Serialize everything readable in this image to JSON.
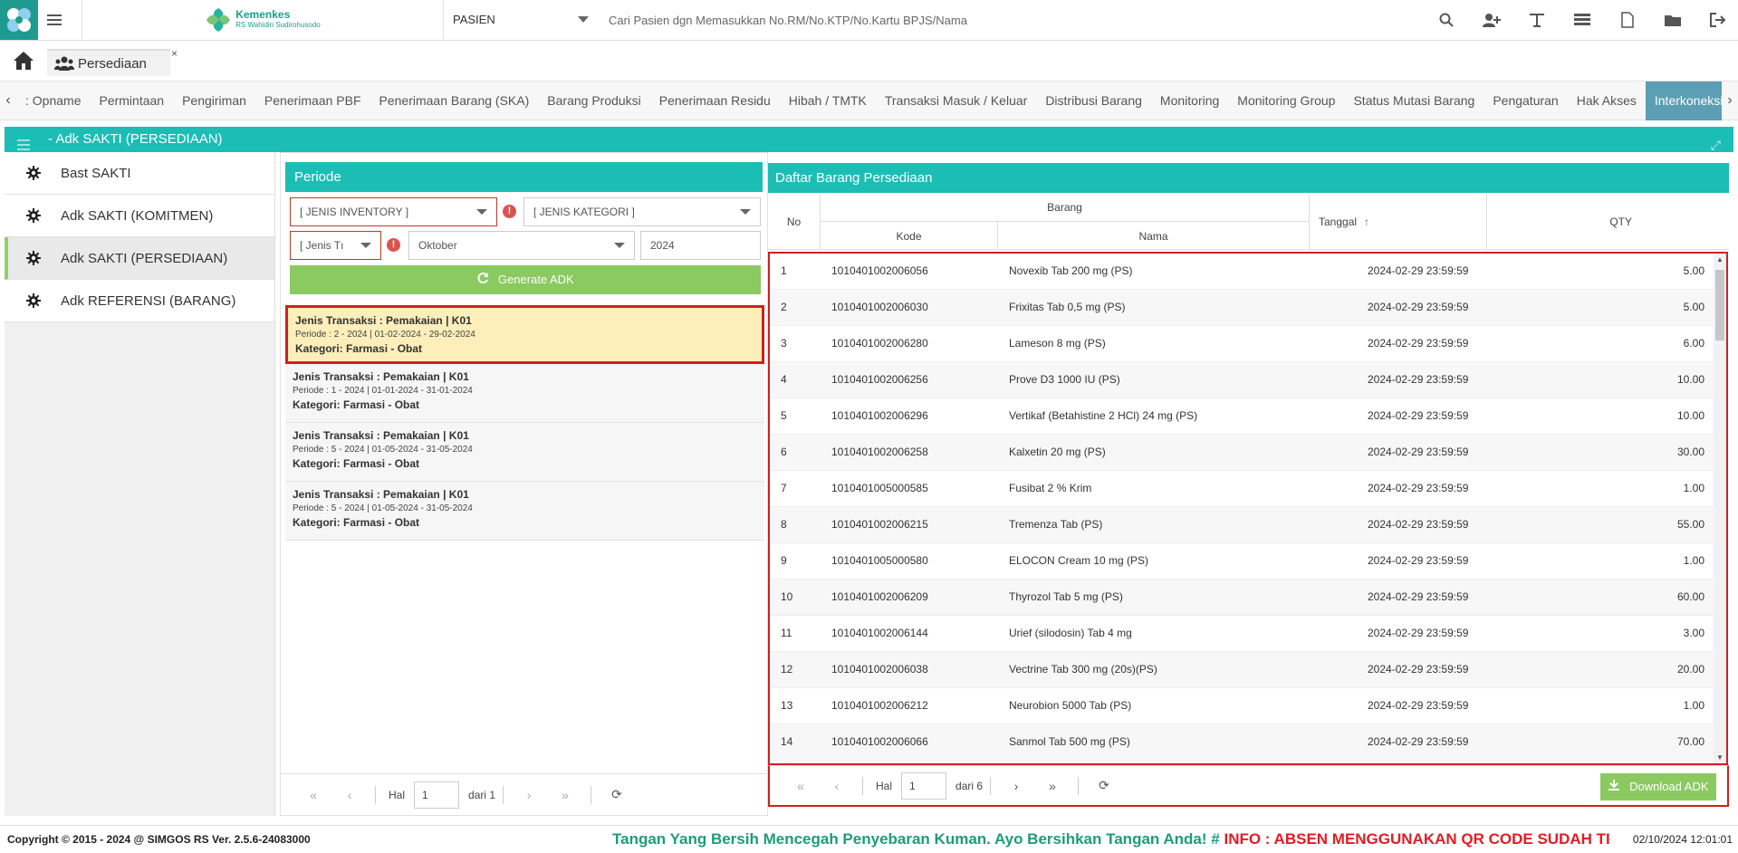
{
  "header": {
    "brand_title": "Kemenkes",
    "brand_sub": "RS Wahidin Sudirohusodo",
    "patient_select": "PASIEN",
    "search_placeholder": "Cari Pasien dgn Memasukkan No.RM/No.KTP/No.Kartu BPJS/Nama",
    "icons": [
      "search-icon",
      "add-user-icon",
      "text-icon",
      "list-icon",
      "pdf-icon",
      "folder-icon",
      "logout-icon"
    ]
  },
  "tab": {
    "label": "Persediaan",
    "close": "×"
  },
  "menu": {
    "items": [
      ": Opname",
      "Permintaan",
      "Pengiriman",
      "Penerimaan PBF",
      "Penerimaan Barang (SKA)",
      "Barang Produksi",
      "Penerimaan Residu",
      "Hibah / TMTK",
      "Transaksi Masuk / Keluar",
      "Distribusi Barang",
      "Monitoring",
      "Monitoring Group",
      "Status Mutasi Barang",
      "Pengaturan",
      "Hak Akses",
      "Interkoneksi SAKTI"
    ],
    "active": "Interkoneksi SAKTI"
  },
  "panel": {
    "title": "- Adk SAKTI (PERSEDIAAN)"
  },
  "sidebar": {
    "items": [
      "Bast SAKTI",
      "Adk SAKTI (KOMITMEN)",
      "Adk SAKTI (PERSEDIAAN)",
      "Adk REFERENSI (BARANG)"
    ],
    "active": "Adk SAKTI (PERSEDIAAN)"
  },
  "periode": {
    "title": "Periode",
    "jenis_inventory": "[ JENIS INVENTORY ]",
    "jenis_kategori": "[ JENIS KATEGORI ]",
    "jenis_transaksi": "[ Jenis Tı",
    "bulan": "Oktober",
    "tahun": "2024",
    "generate_label": "Generate ADK",
    "list": [
      {
        "l1": "Jenis Transaksi : Pemakaian | K01",
        "l2": "Periode : 2 - 2024 | 01-02-2024 - 29-02-2024",
        "l3": "Kategori: Farmasi - Obat"
      },
      {
        "l1": "Jenis Transaksi : Pemakaian | K01",
        "l2": "Periode : 1 - 2024 | 01-01-2024 - 31-01-2024",
        "l3": "Kategori: Farmasi - Obat"
      },
      {
        "l1": "Jenis Transaksi : Pemakaian | K01",
        "l2": "Periode : 5 - 2024 | 01-05-2024 - 31-05-2024",
        "l3": "Kategori: Farmasi - Obat"
      },
      {
        "l1": "Jenis Transaksi : Pemakaian | K01",
        "l2": "Periode : 5 - 2024 | 01-05-2024 - 31-05-2024",
        "l3": "Kategori: Farmasi - Obat"
      }
    ],
    "pager": {
      "hal": "Hal",
      "page": "1",
      "dari": "dari 1"
    }
  },
  "barang": {
    "title": "Daftar Barang Persediaan",
    "headers": {
      "no": "No",
      "barang": "Barang",
      "kode": "Kode",
      "nama": "Nama",
      "tanggal": "Tanggal",
      "qty": "QTY"
    },
    "rows": [
      {
        "no": "1",
        "kode": "1010401002006056",
        "nama": "Novexib Tab 200 mg (PS)",
        "tanggal": "2024-02-29 23:59:59",
        "qty": "5.00"
      },
      {
        "no": "2",
        "kode": "1010401002006030",
        "nama": "Frixitas Tab 0,5 mg (PS)",
        "tanggal": "2024-02-29 23:59:59",
        "qty": "5.00"
      },
      {
        "no": "3",
        "kode": "1010401002006280",
        "nama": "Lameson 8 mg (PS)",
        "tanggal": "2024-02-29 23:59:59",
        "qty": "6.00"
      },
      {
        "no": "4",
        "kode": "1010401002006256",
        "nama": "Prove D3 1000 IU (PS)",
        "tanggal": "2024-02-29 23:59:59",
        "qty": "10.00"
      },
      {
        "no": "5",
        "kode": "1010401002006296",
        "nama": "Vertikaf (Betahistine 2 HCl) 24 mg (PS)",
        "tanggal": "2024-02-29 23:59:59",
        "qty": "10.00"
      },
      {
        "no": "6",
        "kode": "1010401002006258",
        "nama": "Kalxetin 20 mg (PS)",
        "tanggal": "2024-02-29 23:59:59",
        "qty": "30.00"
      },
      {
        "no": "7",
        "kode": "1010401005000585",
        "nama": "Fusibat 2 % Krim",
        "tanggal": "2024-02-29 23:59:59",
        "qty": "1.00"
      },
      {
        "no": "8",
        "kode": "1010401002006215",
        "nama": "Tremenza Tab (PS)",
        "tanggal": "2024-02-29 23:59:59",
        "qty": "55.00"
      },
      {
        "no": "9",
        "kode": "1010401005000580",
        "nama": "ELOCON Cream 10 mg (PS)",
        "tanggal": "2024-02-29 23:59:59",
        "qty": "1.00"
      },
      {
        "no": "10",
        "kode": "1010401002006209",
        "nama": "Thyrozol Tab 5 mg (PS)",
        "tanggal": "2024-02-29 23:59:59",
        "qty": "60.00"
      },
      {
        "no": "11",
        "kode": "1010401002006144",
        "nama": "Urief (silodosin) Tab 4 mg",
        "tanggal": "2024-02-29 23:59:59",
        "qty": "3.00"
      },
      {
        "no": "12",
        "kode": "1010401002006038",
        "nama": "Vectrine Tab 300 mg (20s)(PS)",
        "tanggal": "2024-02-29 23:59:59",
        "qty": "20.00"
      },
      {
        "no": "13",
        "kode": "1010401002006212",
        "nama": "Neurobion 5000 Tab (PS)",
        "tanggal": "2024-02-29 23:59:59",
        "qty": "1.00"
      },
      {
        "no": "14",
        "kode": "1010401002006066",
        "nama": "Sanmol Tab 500 mg (PS)",
        "tanggal": "2024-02-29 23:59:59",
        "qty": "70.00"
      }
    ],
    "pager": {
      "hal": "Hal",
      "page": "1",
      "dari": "dari 6"
    },
    "download_label": "Download ADK"
  },
  "footer": {
    "copyright": "Copyright © 2015 - 2024 @ SIMGOS RS Ver. 2.5.6-24083000",
    "marquee_green": "Tangan Yang Bersih Mencegah Penyebaran Kuman. Ayo Bersihkan Tangan Anda! #",
    "marquee_red": "INFO : ABSEN MENGGUNAKAN QR CODE SUDAH TI",
    "datetime": "02/10/2024 12:01:01"
  }
}
